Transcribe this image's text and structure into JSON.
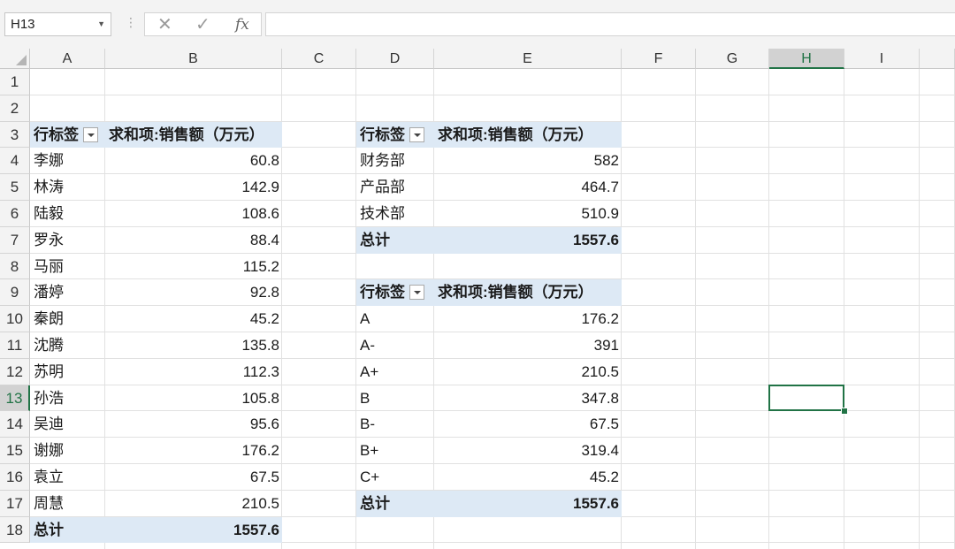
{
  "formula_bar": {
    "name_box": "H13",
    "cancel_symbol": "✕",
    "enter_symbol": "✓",
    "fx_label": "fx",
    "formula": ""
  },
  "columns": [
    "A",
    "B",
    "C",
    "D",
    "E",
    "F",
    "G",
    "H",
    "I"
  ],
  "rows": [
    "1",
    "2",
    "3",
    "4",
    "5",
    "6",
    "7",
    "8",
    "9",
    "10",
    "11",
    "12",
    "13",
    "14",
    "15",
    "16",
    "17",
    "18"
  ],
  "active_cell": {
    "column": "H",
    "row": "13"
  },
  "accent_color": "#217346",
  "band_color": "#dde9f5",
  "pivot_by_name": {
    "header_label": "行标签",
    "header_value": "求和项:销售额（万元）",
    "rows": [
      {
        "label": "李娜",
        "value": "60.8"
      },
      {
        "label": "林涛",
        "value": "142.9"
      },
      {
        "label": "陆毅",
        "value": "108.6"
      },
      {
        "label": "罗永",
        "value": "88.4"
      },
      {
        "label": "马丽",
        "value": "115.2"
      },
      {
        "label": "潘婷",
        "value": "92.8"
      },
      {
        "label": "秦朗",
        "value": "45.2"
      },
      {
        "label": "沈腾",
        "value": "135.8"
      },
      {
        "label": "苏明",
        "value": "112.3"
      },
      {
        "label": "孙浩",
        "value": "105.8"
      },
      {
        "label": "吴迪",
        "value": "95.6"
      },
      {
        "label": "谢娜",
        "value": "176.2"
      },
      {
        "label": "袁立",
        "value": "67.5"
      },
      {
        "label": "周慧",
        "value": "210.5"
      }
    ],
    "total_label": "总计",
    "total_value": "1557.6"
  },
  "pivot_by_department": {
    "header_label": "行标签",
    "header_value": "求和项:销售额（万元）",
    "rows": [
      {
        "label": "财务部",
        "value": "582"
      },
      {
        "label": "产品部",
        "value": "464.7"
      },
      {
        "label": "技术部",
        "value": "510.9"
      }
    ],
    "total_label": "总计",
    "total_value": "1557.6"
  },
  "pivot_by_grade": {
    "header_label": "行标签",
    "header_value": "求和项:销售额（万元）",
    "rows": [
      {
        "label": "A",
        "value": "176.2"
      },
      {
        "label": "A-",
        "value": "391"
      },
      {
        "label": "A+",
        "value": "210.5"
      },
      {
        "label": "B",
        "value": "347.8"
      },
      {
        "label": "B-",
        "value": "67.5"
      },
      {
        "label": "B+",
        "value": "319.4"
      },
      {
        "label": "C+",
        "value": "45.2"
      }
    ],
    "total_label": "总计",
    "total_value": "1557.6"
  }
}
